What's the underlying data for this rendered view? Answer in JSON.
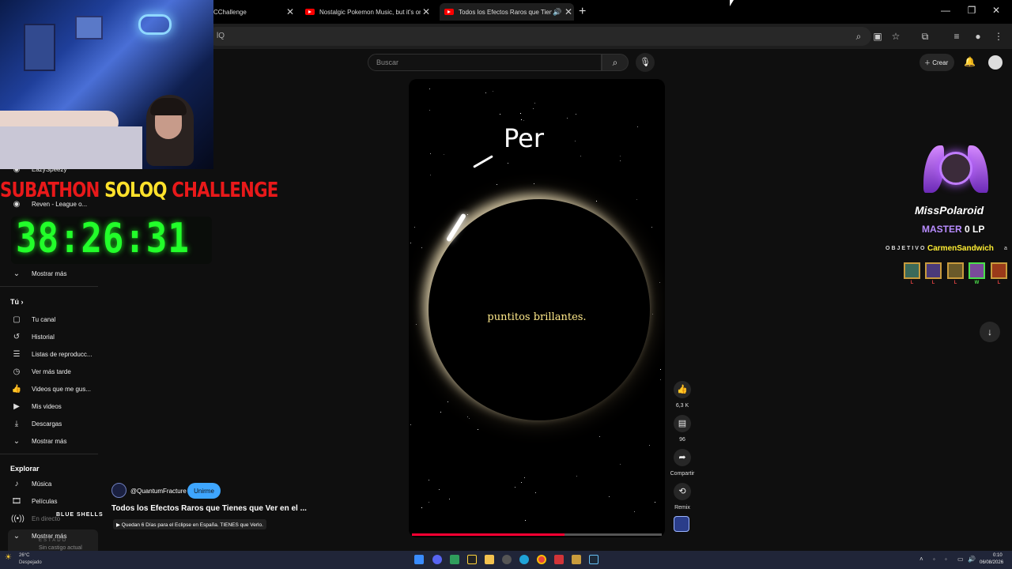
{
  "browser": {
    "tabs": [
      {
        "title": "CChallenge"
      },
      {
        "title": "Nostalgic Pokemon Music, but it's only generat"
      },
      {
        "title": "Todos los Efectos Raros que Tienes que V"
      }
    ],
    "address_text": "lQ"
  },
  "youtube": {
    "search_placeholder": "Buscar",
    "create_label": "Crear"
  },
  "sidebar": {
    "subs": [
      {
        "label": "EazySpeezy"
      },
      {
        "label": "Reven - League o..."
      }
    ],
    "more1": "Mostrar más",
    "you_heading": "Tú",
    "you_items": [
      {
        "label": "Tu canal",
        "icon": "user-square-icon"
      },
      {
        "label": "Historial",
        "icon": "history-icon"
      },
      {
        "label": "Listas de reproducc...",
        "icon": "playlist-icon"
      },
      {
        "label": "Ver más tarde",
        "icon": "clock-icon"
      },
      {
        "label": "Videos que me gus...",
        "icon": "thumbs-up-icon"
      },
      {
        "label": "Mis videos",
        "icon": "video-icon"
      },
      {
        "label": "Descargas",
        "icon": "download-icon"
      }
    ],
    "more2": "Mostrar más",
    "explore_heading": "Explorar",
    "explore_items": [
      {
        "label": "Música",
        "icon": "music-icon"
      },
      {
        "label": "Películas",
        "icon": "film-icon"
      },
      {
        "label": "En directo",
        "icon": "live-icon"
      }
    ],
    "more3": "Mostrar más"
  },
  "stream_overlay": {
    "banner_red1": "SUBATHON",
    "banner_yellow": "SOLOQ",
    "banner_red2": "CHALLENGE",
    "timer": "38:26:31",
    "blue_shells": "BLUE SHELLS",
    "estado_label": "ESTADO",
    "estado_value": "Sin castigo actual",
    "player_name": "MissPolaroid",
    "rank_tier": "MASTER",
    "rank_lp": "0 LP",
    "objetivo_label": "OBJETIVO",
    "objetivo_target": "CarmenSandwich",
    "objetivo_suffix": "a",
    "match_results": [
      {
        "result": "L",
        "color": "#e04040"
      },
      {
        "result": "L",
        "color": "#e04040"
      },
      {
        "result": "L",
        "color": "#e04040"
      },
      {
        "result": "W",
        "color": "#4be04b"
      },
      {
        "result": "L",
        "color": "#e04040"
      }
    ]
  },
  "video": {
    "overlay_word": "Per",
    "caption": "puntitos brillantes.",
    "progress_fraction": 0.61,
    "likes": "6,3 K",
    "comments": "96",
    "share_label": "Compartir",
    "remix_label": "Remix"
  },
  "channel": {
    "name": "@QuantumFracture",
    "join_label": "Unirme",
    "title": "Todos los Efectos Raros que Tienes que Ver en el ...",
    "subtitle": "▶ Quedan 6 Días para el Eclipse en España. TIENES que Verlo."
  },
  "taskbar": {
    "weather_temp": "26°C",
    "weather_status": "Despejado",
    "time": "0:10",
    "date": "06/08/2026"
  }
}
